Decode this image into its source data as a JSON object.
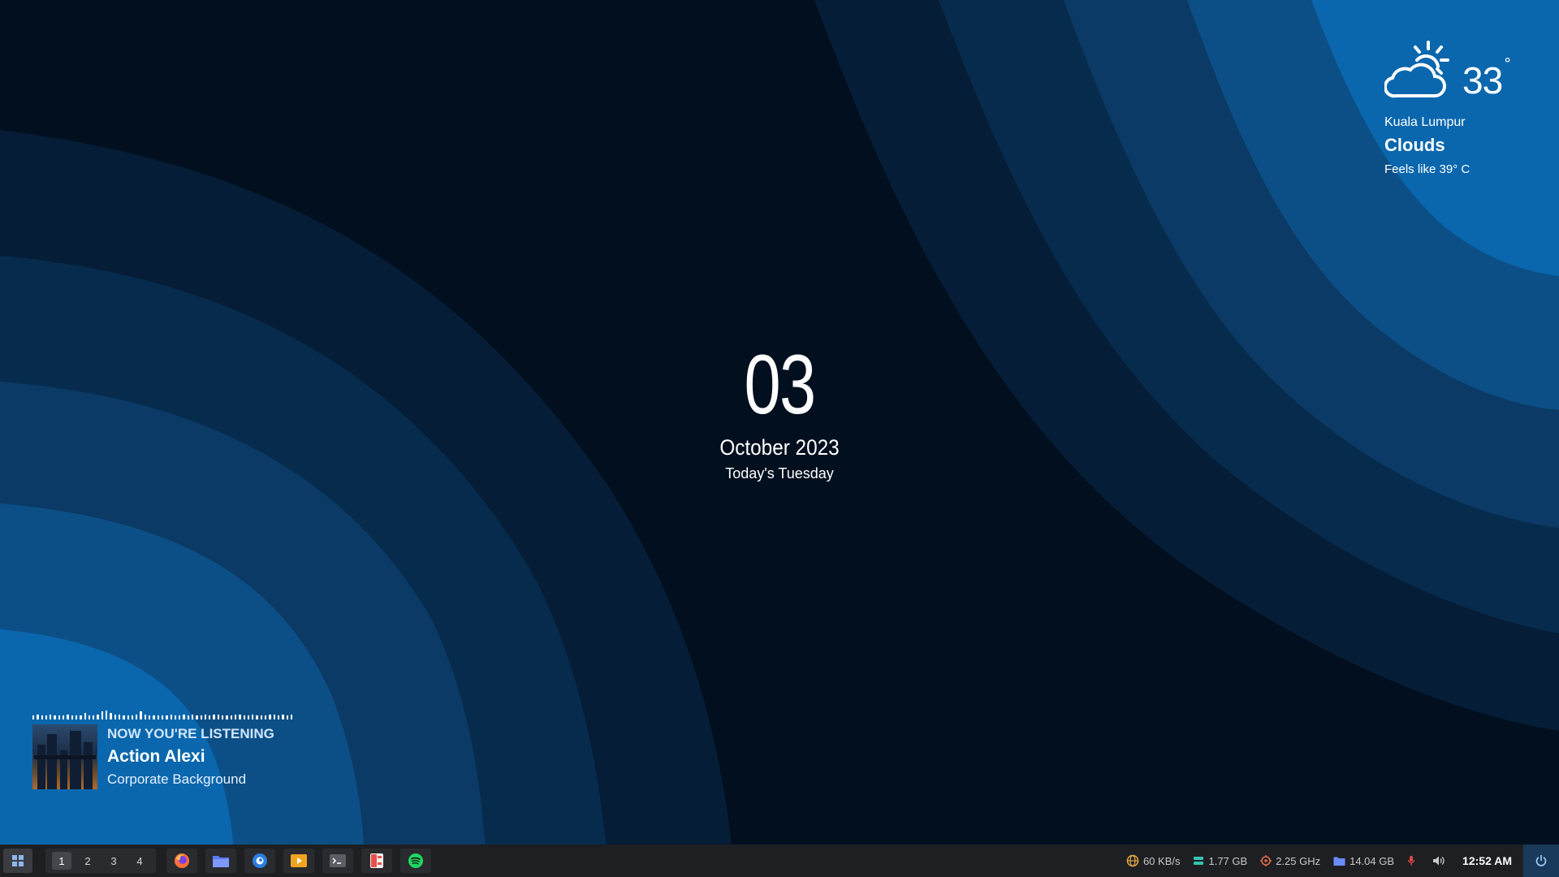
{
  "weather": {
    "icon": "partly-cloudy-icon",
    "temperature": "33",
    "degree_symbol": "°",
    "city": "Kuala Lumpur",
    "condition": "Clouds",
    "feels_like": "Feels like 39° C"
  },
  "clock": {
    "day": "03",
    "month_year": "October 2023",
    "weekday_text": "Today's Tuesday"
  },
  "music": {
    "heading": "NOW YOU'RE LISTENING",
    "artist": "Action Alexi",
    "title": "Corporate Background",
    "visualizer_levels": [
      0.3,
      0.4,
      0.3,
      0.3,
      0.4,
      0.3,
      0.3,
      0.3,
      0.4,
      0.3,
      0.3,
      0.3,
      0.5,
      0.3,
      0.3,
      0.4,
      0.6,
      0.7,
      0.5,
      0.4,
      0.4,
      0.3,
      0.3,
      0.3,
      0.4,
      0.6,
      0.4,
      0.3,
      0.3,
      0.3,
      0.3,
      0.3,
      0.4,
      0.3,
      0.3,
      0.4,
      0.3,
      0.4,
      0.3,
      0.3,
      0.4,
      0.3,
      0.4,
      0.4,
      0.3,
      0.3,
      0.3,
      0.4,
      0.4,
      0.3,
      0.3,
      0.4,
      0.3,
      0.3,
      0.3,
      0.4,
      0.4,
      0.3,
      0.4,
      0.3,
      0.4
    ]
  },
  "taskbar": {
    "start_icon": "grid-start-icon",
    "workspaces": [
      "1",
      "2",
      "3",
      "4"
    ],
    "active_workspace": "1",
    "apps": [
      "firefox-icon",
      "file-manager-icon",
      "browser-icon",
      "media-player-icon",
      "terminal-icon",
      "settings-icon",
      "spotify-icon"
    ],
    "tray": {
      "network": "60 KB/s",
      "memory": "1.77 GB",
      "cpu": "2.25 GHz",
      "disk": "14.04 GB",
      "time": "12:52 AM"
    },
    "colors": {
      "bar": "#1e1f22",
      "network": "#e8a946",
      "memory": "#33c5b3",
      "cpu": "#e06c4b",
      "disk": "#6a8cff",
      "alert": "#e04848"
    }
  }
}
